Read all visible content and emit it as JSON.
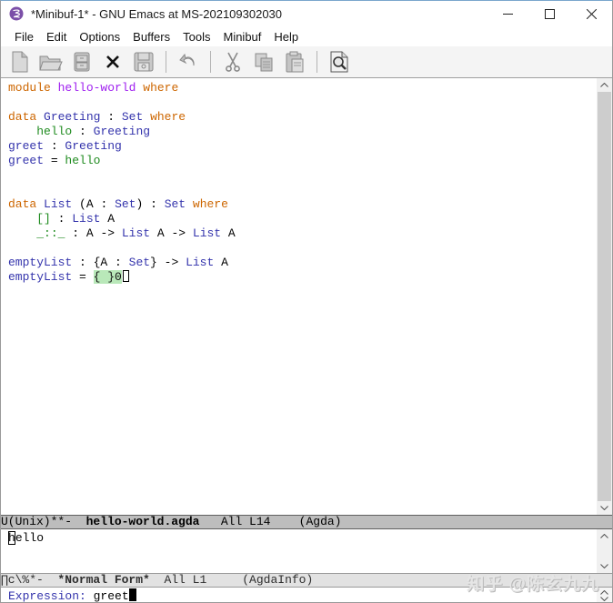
{
  "window": {
    "title": "*Minibuf-1* - GNU Emacs at MS-202109302030",
    "controls": [
      "minimize",
      "maximize",
      "close"
    ]
  },
  "menu": {
    "items": [
      "File",
      "Edit",
      "Options",
      "Buffers",
      "Tools",
      "Minibuf",
      "Help"
    ]
  },
  "toolbar": {
    "icons": [
      "new-file",
      "open-folder",
      "dired",
      "close-buffer",
      "save",
      "undo",
      "cut",
      "copy",
      "paste",
      "search"
    ]
  },
  "editor": {
    "filename": "hello-world.agda",
    "lines": [
      [
        [
          "module",
          "keyword"
        ],
        [
          " ",
          ""
        ],
        [
          "hello-world",
          "module"
        ],
        [
          " ",
          ""
        ],
        [
          "where",
          "keyword"
        ]
      ],
      [],
      [
        [
          "data",
          "keyword"
        ],
        [
          " ",
          ""
        ],
        [
          "Greeting",
          "type"
        ],
        [
          " : ",
          ""
        ],
        [
          "Set",
          "type"
        ],
        [
          " ",
          ""
        ],
        [
          "where",
          "keyword"
        ]
      ],
      [
        [
          "    ",
          ""
        ],
        [
          "hello",
          "ctor"
        ],
        [
          " : ",
          ""
        ],
        [
          "Greeting",
          "type"
        ]
      ],
      [
        [
          "greet",
          "fn"
        ],
        [
          " : ",
          ""
        ],
        [
          "Greeting",
          "type"
        ]
      ],
      [
        [
          "greet",
          "fn"
        ],
        [
          " = ",
          ""
        ],
        [
          "hello",
          "ctor"
        ]
      ],
      [],
      [],
      [
        [
          "data",
          "keyword"
        ],
        [
          " ",
          ""
        ],
        [
          "List",
          "type"
        ],
        [
          " (A : ",
          ""
        ],
        [
          "Set",
          "type"
        ],
        [
          ") : ",
          ""
        ],
        [
          "Set",
          "type"
        ],
        [
          " ",
          ""
        ],
        [
          "where",
          "keyword"
        ]
      ],
      [
        [
          "    ",
          ""
        ],
        [
          "[]",
          "ctor"
        ],
        [
          " : ",
          ""
        ],
        [
          "List",
          "type"
        ],
        [
          " A",
          ""
        ]
      ],
      [
        [
          "    ",
          ""
        ],
        [
          "_::_",
          "ctor"
        ],
        [
          " : A -> ",
          ""
        ],
        [
          "List",
          "type"
        ],
        [
          " A -> ",
          ""
        ],
        [
          "List",
          "type"
        ],
        [
          " A",
          ""
        ]
      ],
      [],
      [
        [
          "emptyList",
          "fn"
        ],
        [
          " : {A : ",
          ""
        ],
        [
          "Set",
          "type"
        ],
        [
          "} -> ",
          ""
        ],
        [
          "List",
          "type"
        ],
        [
          " A",
          ""
        ]
      ],
      [
        [
          "emptyList",
          "fn"
        ],
        [
          " = ",
          ""
        ],
        [
          "{ }0",
          "hole"
        ],
        [
          "",
          "cursor-hollow"
        ]
      ]
    ]
  },
  "modeline1": {
    "prefix": "U(Unix)**-  ",
    "buffer": "hello-world.agda",
    "suffix": "   All L14    (Agda)"
  },
  "normal_form": {
    "lines": [
      [
        [
          "h",
          "cursor-on"
        ],
        [
          "ello",
          ""
        ]
      ]
    ]
  },
  "modeline2": {
    "prefix": "∏c\\%*-  ",
    "buffer": "*Normal Form*",
    "suffix": "  All L1     (AgdaInfo)"
  },
  "minibuffer": {
    "prompt": "Expression:",
    "value": " greet"
  },
  "watermark": "知乎 @陈玄九九",
  "colors": {
    "keyword": "#cd6600",
    "module_name": "#a020f0",
    "datatype_function": "#3434ac",
    "constructor": "#1f8b1f",
    "goal_background": "#b9e8b9",
    "modeline_active_bg": "#bdbdbd",
    "modeline_inactive_bg": "#e2e2e2",
    "toolbar_bg": "#f4f4f4",
    "emacs_icon": "#7b4fa8"
  }
}
